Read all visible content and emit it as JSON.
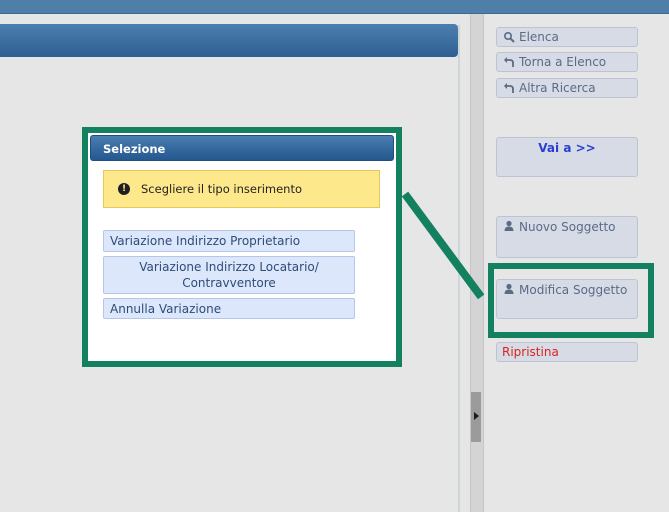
{
  "sidebar": {
    "elenca": "Elenca",
    "torna": "Torna a Elenco",
    "altra": "Altra Ricerca",
    "vai": "Vai a >>",
    "nuovo": "Nuovo Soggetto",
    "modifica": "Modifica Soggetto",
    "ripristina": "Ripristina"
  },
  "dialog": {
    "title": "Selezione",
    "warning": "Scegliere il tipo inserimento",
    "options": [
      "Variazione Indirizzo Proprietario",
      "Variazione Indirizzo Locatario/",
      "Contravventore",
      "Annulla Variazione"
    ]
  },
  "colors": {
    "highlight": "#138060",
    "header": "#2f5f92",
    "warning": "#fde98b"
  },
  "icons": {
    "search": "search-icon",
    "back": "back-arrow-icon",
    "user": "user-icon",
    "warning": "exclamation-icon"
  }
}
